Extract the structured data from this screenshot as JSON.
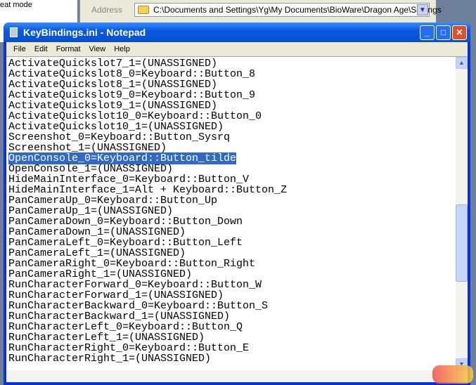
{
  "background": {
    "partial_text": "eat mode",
    "address_label": "Address",
    "address_path": "C:\\Documents and Settings\\Yg\\My Documents\\BioWare\\Dragon Age\\Settings"
  },
  "window": {
    "title": "KeyBindings.ini - Notepad",
    "minimize": "_",
    "maximize": "□",
    "close": "✕"
  },
  "menu": [
    "File",
    "Edit",
    "Format",
    "View",
    "Help"
  ],
  "lines": [
    "ActivateQuickslot7_1=(UNASSIGNED)",
    "ActivateQuickslot8_0=Keyboard::Button_8",
    "ActivateQuickslot8_1=(UNASSIGNED)",
    "ActivateQuickslot9_0=Keyboard::Button_9",
    "ActivateQuickslot9_1=(UNASSIGNED)",
    "ActivateQuickslot10_0=Keyboard::Button_0",
    "ActivateQuickslot10_1=(UNASSIGNED)",
    "Screenshot_0=Keyboard::Button_Sysrq",
    "Screenshot_1=(UNASSIGNED)",
    "OpenConsole_0=Keyboard::Button_tilde",
    "OpenConsole_1=(UNASSIGNED)",
    "HideMainInterface_0=Keyboard::Button_V",
    "HideMainInterface_1=Alt + Keyboard::Button_Z",
    "PanCameraUp_0=Keyboard::Button_Up",
    "PanCameraUp_1=(UNASSIGNED)",
    "PanCameraDown_0=Keyboard::Button_Down",
    "PanCameraDown_1=(UNASSIGNED)",
    "PanCameraLeft_0=Keyboard::Button_Left",
    "PanCameraLeft_1=(UNASSIGNED)",
    "PanCameraRight_0=Keyboard::Button_Right",
    "PanCameraRight_1=(UNASSIGNED)",
    "RunCharacterForward_0=Keyboard::Button_W",
    "RunCharacterForward_1=(UNASSIGNED)",
    "RunCharacterBackward_0=Keyboard::Button_S",
    "RunCharacterBackward_1=(UNASSIGNED)",
    "RunCharacterLeft_0=Keyboard::Button_Q",
    "RunCharacterLeft_1=(UNASSIGNED)",
    "RunCharacterRight_0=Keyboard::Button_E",
    "RunCharacterRight_1=(UNASSIGNED)"
  ],
  "selected_line_index": 9,
  "scroll_position_percent": 68,
  "watermark": "游侠网",
  "colors": {
    "title_bar": "#0a5ae0",
    "selection": "#316ac5"
  }
}
